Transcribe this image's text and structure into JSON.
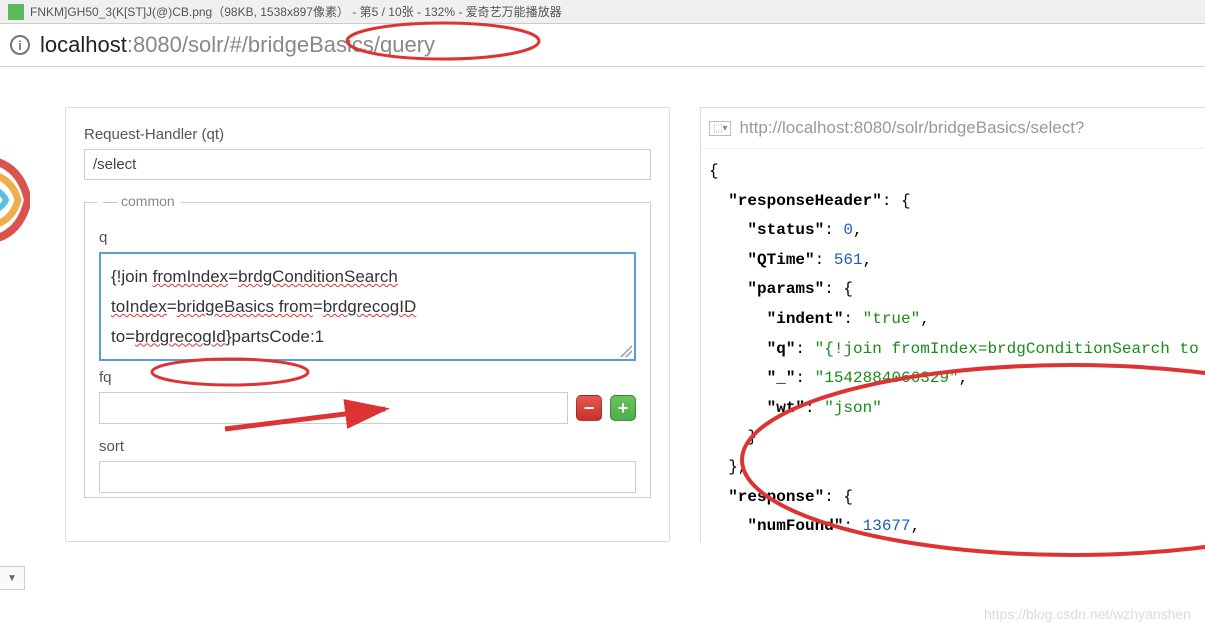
{
  "titlebar": {
    "text": "FNKM]GH50_3(K[ST]J(@)CB.png（98KB, 1538x897像素） - 第5 / 10张 - 132% - 爱奇艺万能播放器"
  },
  "addressbar": {
    "info_glyph": "i",
    "host": "localhost",
    "rest": ":8080/solr/#/bridgeBasics/query"
  },
  "form": {
    "qt_label": "Request-Handler (qt)",
    "qt_value": "/select",
    "common_legend": "common",
    "q_label": "q",
    "q_parts": {
      "p1": "{!join ",
      "w1": "fromIndex",
      "p2": "=",
      "w2": "brdgConditionSearch",
      "p3": " ",
      "w3": "toIndex",
      "p4": "=",
      "w4": "bridgeBasics from",
      "p5": "=",
      "w5": "brdgrecogID",
      "p6": " to=",
      "w6": "brdgrecogId",
      "p7": "}partsCode:1"
    },
    "fq_label": "fq",
    "fq_value": "",
    "sort_label": "sort",
    "sort_value": "",
    "minus_glyph": "−",
    "plus_glyph": "+"
  },
  "right": {
    "url_icon": "⬚▾",
    "url_text": "http://localhost:8080/solr/bridgeBasics/select?"
  },
  "json": {
    "l0": "{",
    "k_responseHeader": "\"responseHeader\"",
    "k_status": "\"status\"",
    "v_status": "0",
    "k_qtime": "\"QTime\"",
    "v_qtime": "561",
    "k_params": "\"params\"",
    "k_indent": "\"indent\"",
    "v_indent": "\"true\"",
    "k_q": "\"q\"",
    "v_q": "\"{!join fromIndex=brdgConditionSearch to",
    "k_us": "\"_\"",
    "v_us": "\"1542884066329\"",
    "k_wt": "\"wt\"",
    "v_wt": "\"json\"",
    "k_response": "\"response\"",
    "k_numFound": "\"numFound\"",
    "v_numFound": "13677"
  },
  "watermark": "https://blog.csdn.net/wzhyanshen",
  "dropdown_glyph": "▼"
}
